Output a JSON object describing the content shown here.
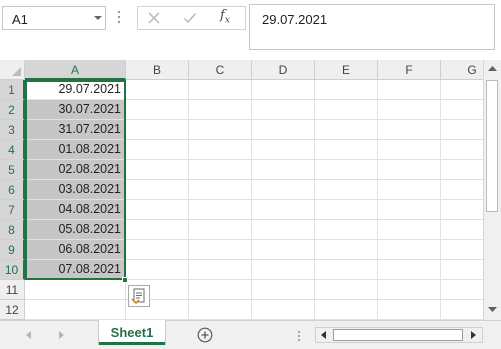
{
  "formula_bar": {
    "name_box": "A1",
    "cancel_icon": "cancel-x-icon",
    "enter_icon": "enter-check-icon",
    "fx_label": "fx",
    "formula_value": "29.07.2021"
  },
  "grid": {
    "columns": [
      "A",
      "B",
      "C",
      "D",
      "E",
      "F",
      "G"
    ],
    "rows": [
      "1",
      "2",
      "3",
      "4",
      "5",
      "6",
      "7",
      "8",
      "9",
      "10",
      "11",
      "12"
    ],
    "column_a_values": [
      "29.07.2021",
      "30.07.2021",
      "31.07.2021",
      "01.08.2021",
      "02.08.2021",
      "03.08.2021",
      "04.08.2021",
      "05.08.2021",
      "06.08.2021",
      "07.08.2021",
      "",
      ""
    ],
    "selected_range": "A1:A10",
    "selection_color": "#217346",
    "selected_fill": "#c6c6c6"
  },
  "sheets": {
    "tabs": [
      "Sheet1"
    ],
    "active": "Sheet1",
    "add_icon": "plus-circle-icon"
  }
}
